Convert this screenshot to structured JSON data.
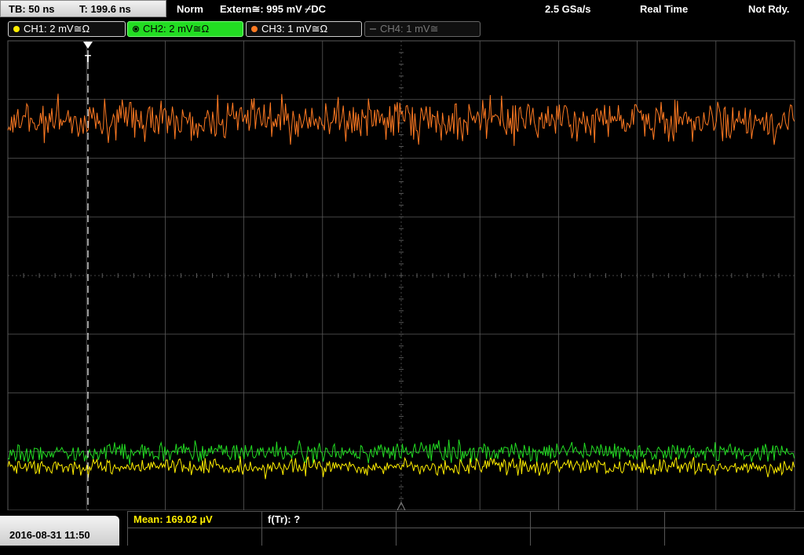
{
  "topbar": {
    "timebase": "TB: 50 ns",
    "trigger_time": "T: 199.6 ns",
    "mode": "Norm",
    "trigger_source": "Extern≅: 995 mV ⌿DC",
    "sample_rate": "2.5 GSa/s",
    "acq_mode": "Real Time",
    "status": "Not Rdy."
  },
  "channels": [
    {
      "label": "CH1: 2 mV≅Ω",
      "color": "#ffee00",
      "state": "on"
    },
    {
      "label": "CH2: 2 mV≅Ω",
      "color": "#22dd22",
      "state": "selected"
    },
    {
      "label": "CH3: 1 mV≅Ω",
      "color": "#ff7a22",
      "state": "on"
    },
    {
      "label": "CH4: 1 mV≅",
      "color": "#777777",
      "state": "off"
    }
  ],
  "traces": {
    "ch3_color": "#ff7a22",
    "ch2_color": "#22dd22",
    "ch1_color": "#ffee00",
    "grid_color": "#5a5a5a"
  },
  "bottom": {
    "datetime": "2016-08-31 11:50",
    "mean_label": "Mean: 169.02 µV",
    "mean_color": "#ffee00",
    "ftr_label": "f(Tr): ?"
  }
}
